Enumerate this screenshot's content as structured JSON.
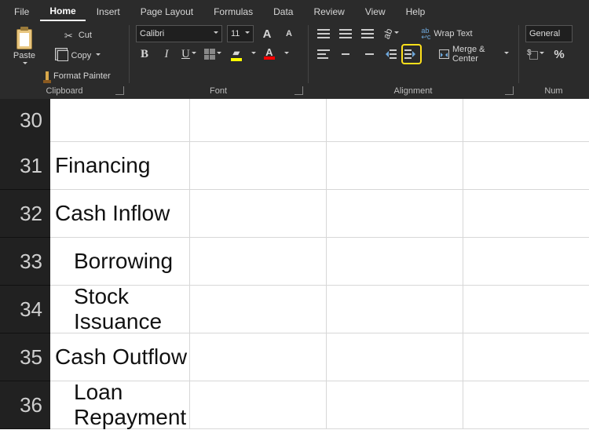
{
  "tabs": {
    "file": "File",
    "home": "Home",
    "insert": "Insert",
    "page_layout": "Page Layout",
    "formulas": "Formulas",
    "data": "Data",
    "review": "Review",
    "view": "View",
    "help": "Help"
  },
  "clipboard": {
    "paste": "Paste",
    "cut": "Cut",
    "copy": "Copy",
    "format_painter": "Format Painter",
    "group_label": "Clipboard"
  },
  "font": {
    "name": "Calibri",
    "size": "11",
    "group_label": "Font"
  },
  "alignment": {
    "wrap": "Wrap Text",
    "merge": "Merge & Center",
    "group_label": "Alignment"
  },
  "number": {
    "format": "General",
    "group_label": "Num"
  },
  "rows": [
    {
      "num": "30",
      "text": "",
      "indent": 0
    },
    {
      "num": "31",
      "text": "Financing",
      "indent": 0
    },
    {
      "num": "32",
      "text": "Cash Inflow",
      "indent": 0
    },
    {
      "num": "33",
      "text": "Borrowing",
      "indent": 1
    },
    {
      "num": "34",
      "text": "Stock Issuance",
      "indent": 1
    },
    {
      "num": "35",
      "text": "Cash Outflow",
      "indent": 0
    },
    {
      "num": "36",
      "text": "Loan Repayment",
      "indent": 1
    }
  ],
  "group_widths": {
    "clipboard": 158,
    "font": 228,
    "alignment": 268,
    "number": 96
  }
}
